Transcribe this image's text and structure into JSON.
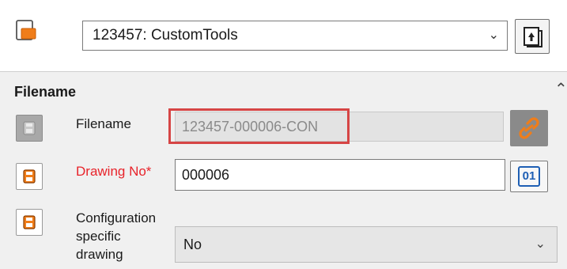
{
  "project": {
    "selected": "123457: CustomTools",
    "chevron_icon": "chevron-down-icon",
    "folder_icon": "orange-folder-icon",
    "action_icon": "upload-document-icon"
  },
  "section": {
    "title": "Filename",
    "collapse_icon": "chevron-up-icon"
  },
  "rows": {
    "filename": {
      "label": "Filename",
      "value": "123457-000006-CON",
      "save_state": "disabled",
      "link_icon": "link-icon"
    },
    "drawing_no": {
      "label": "Drawing No*",
      "value": "000006",
      "generate_label": "01"
    },
    "config_specific": {
      "label_lines": [
        "Configuration",
        "specific",
        "drawing"
      ],
      "value": "No"
    }
  },
  "colors": {
    "required_label": "#e8232a",
    "icon_orange": "#f07d19",
    "highlight_border": "#d64545",
    "number_blue": "#1e5fb4"
  }
}
